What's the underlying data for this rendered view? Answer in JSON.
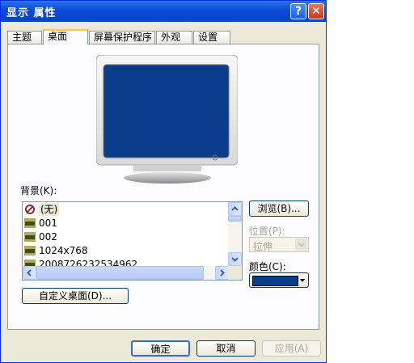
{
  "window": {
    "title": "显示 属性",
    "help_glyph": "?",
    "close_glyph": "✕"
  },
  "tabs": [
    {
      "label": "主题",
      "active": false
    },
    {
      "label": "桌面",
      "active": true
    },
    {
      "label": "屏幕保护程序",
      "active": false
    },
    {
      "label": "外观",
      "active": false
    },
    {
      "label": "设置",
      "active": false
    }
  ],
  "background": {
    "label": "背景(K):",
    "items": [
      {
        "label": "(无)",
        "icon": "none-icon"
      },
      {
        "label": "001",
        "icon": "jpeg-file-icon"
      },
      {
        "label": "002",
        "icon": "jpeg-file-icon"
      },
      {
        "label": "1024x768",
        "icon": "jpeg-file-icon"
      },
      {
        "label": "20087262325349​62",
        "icon": "jpeg-file-icon"
      }
    ]
  },
  "browse_button": "浏览(B)...",
  "position": {
    "label": "位置(P):",
    "value": "拉伸",
    "enabled": false
  },
  "color": {
    "label": "颜色(C):",
    "swatch": "#0a3c8c"
  },
  "customize_button": "自定义桌面(D)...",
  "footer": {
    "ok": "确定",
    "cancel": "取消",
    "apply": "应用(A)"
  },
  "colors": {
    "title_bar": "#0a4bd6",
    "preview_screen": "#0a3c8c",
    "dialog_bg": "#ece9d8"
  }
}
